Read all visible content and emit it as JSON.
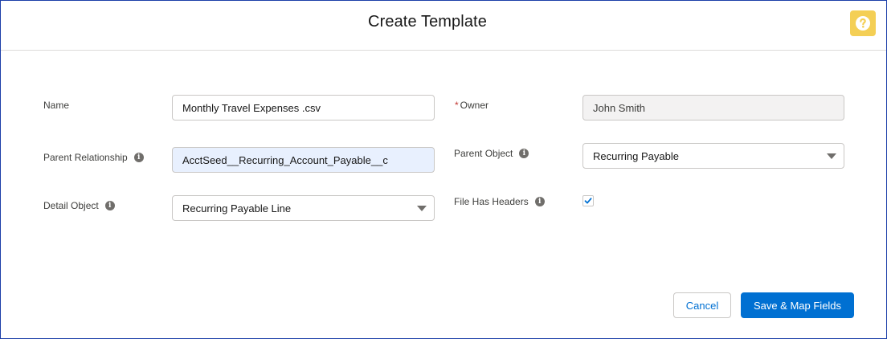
{
  "modal": {
    "title": "Create Template",
    "help_icon": "question-icon"
  },
  "form": {
    "name": {
      "label": "Name",
      "value": "Monthly Travel Expenses .csv"
    },
    "owner": {
      "label": "Owner",
      "required_marker": "*",
      "value": "John Smith"
    },
    "parent_relationship": {
      "label": "Parent Relationship",
      "value": "AcctSeed__Recurring_Account_Payable__c"
    },
    "parent_object": {
      "label": "Parent Object",
      "value": "Recurring Payable"
    },
    "detail_object": {
      "label": "Detail Object",
      "value": "Recurring Payable Line"
    },
    "file_has_headers": {
      "label": "File Has Headers",
      "checked": true
    },
    "info_glyph": "i"
  },
  "footer": {
    "cancel_label": "Cancel",
    "save_label": "Save & Map Fields"
  },
  "colors": {
    "brand": "#0070d2",
    "help_button": "#f4cf55",
    "required": "#c23934",
    "autofill_highlight": "#e8f0fe"
  }
}
